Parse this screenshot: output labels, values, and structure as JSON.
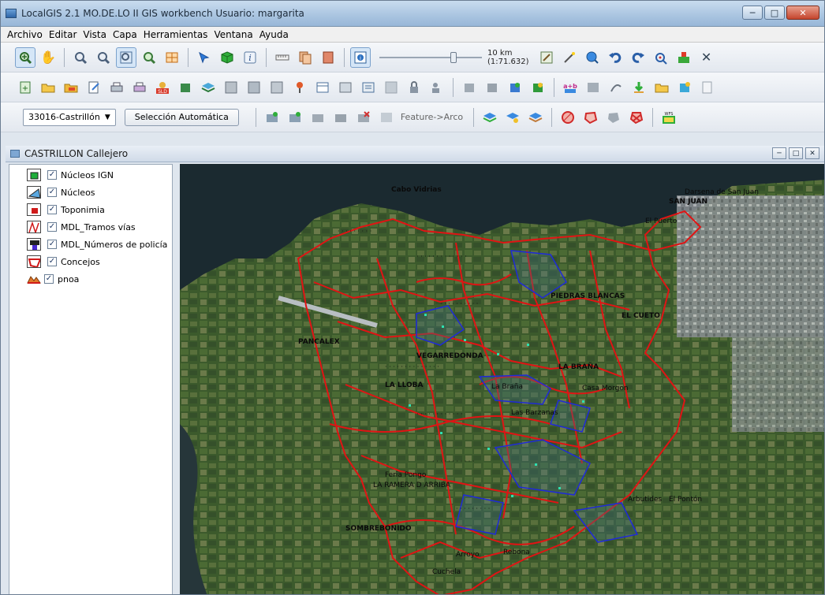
{
  "window": {
    "title": "LocalGIS 2.1 MO.DE.LO II GIS workbench Usuario: margarita",
    "minimize": "─",
    "maximize": "□",
    "close": "✕"
  },
  "menu": [
    "Archivo",
    "Editar",
    "Vista",
    "Capa",
    "Herramientas",
    "Ventana",
    "Ayuda"
  ],
  "toolbar": {
    "scale_km": "10 km",
    "scale_ratio": "(1:71.632)",
    "municipality": "33016-Castrillón",
    "auto_select": "Selección Automática",
    "feature_arc": "Feature->Arco"
  },
  "inner_window": {
    "title": "CASTRILLON Callejero"
  },
  "layers": [
    {
      "name": "Núcleos IGN",
      "checked": true,
      "icon": "nucleos-ign-icon"
    },
    {
      "name": "Núcleos",
      "checked": true,
      "icon": "nucleos-icon"
    },
    {
      "name": "Toponimia",
      "checked": true,
      "icon": "toponimia-icon"
    },
    {
      "name": "MDL_Tramos vías",
      "checked": true,
      "icon": "tramos-vias-icon"
    },
    {
      "name": "MDL_Números de policía",
      "checked": true,
      "icon": "numeros-policia-icon"
    },
    {
      "name": "Concejos",
      "checked": true,
      "icon": "concejos-icon"
    },
    {
      "name": "pnoa",
      "checked": true,
      "icon": "raster-icon"
    }
  ],
  "map_labels": {
    "l1": "Cabo Vidrias",
    "l2": "SAN JUAN",
    "l3": "Darsena de San Juan",
    "l4": "El Puerto",
    "l5": "PIEDRAS BLANCAS",
    "l6": "LA BRAÑA",
    "l7": "EL CUETO",
    "l8": "VEGARREDONDA",
    "l9": "LA LLOBA",
    "l10": "LA RAMERA D ARRIBA",
    "l11": "SOMBREBONIDO",
    "l12": "Feria Pongo",
    "l13": "Rebona",
    "l14": "PANCALEX",
    "l15": "Las Barzanas",
    "l16": "La Braña",
    "l17": "Casa Morgon",
    "l18": "El Pontón",
    "l19": "Arbutides",
    "l20": "Cuchela",
    "l21": "Arroyo"
  },
  "colors": {
    "concejos": "#e01414",
    "nucleos": "#1f2ad8",
    "sea": "#1c2a30"
  }
}
